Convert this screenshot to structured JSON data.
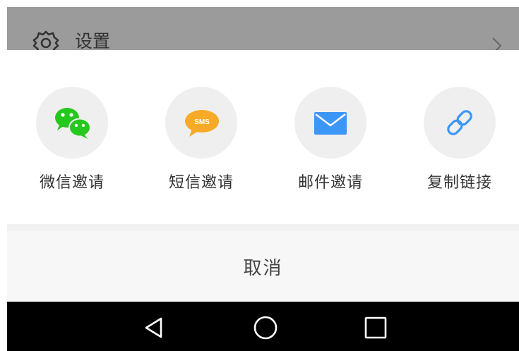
{
  "background_row": {
    "label": "设置",
    "icon": "gear-icon",
    "chevron": "chevron-right-icon"
  },
  "share_sheet": {
    "options": [
      {
        "label": "微信邀请",
        "icon": "wechat-icon",
        "color": "#26c81e"
      },
      {
        "label": "短信邀请",
        "icon": "sms-icon",
        "icon_text": "SMS",
        "color": "#f7a928"
      },
      {
        "label": "邮件邀请",
        "icon": "mail-icon",
        "color": "#3c96f5"
      },
      {
        "label": "复制链接",
        "icon": "link-icon",
        "color": "#3c96f5"
      }
    ],
    "cancel_label": "取消"
  },
  "nav_bar": {
    "back": "triangle-back-icon",
    "home": "circle-home-icon",
    "recents": "square-recents-icon"
  }
}
